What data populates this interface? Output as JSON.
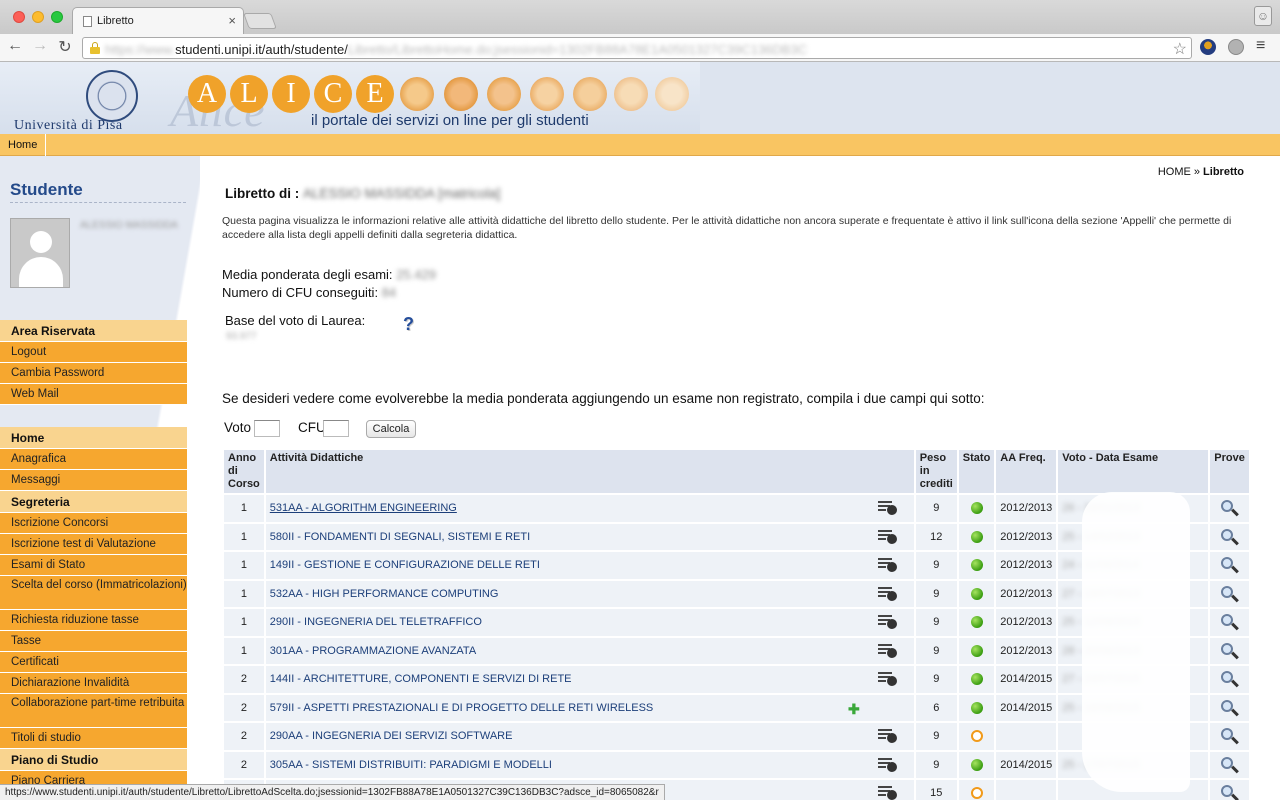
{
  "browser": {
    "tab_title": "Libretto",
    "url_visible": "studenti.unipi.it/auth/studente/",
    "url_blurred_pre": "https://www.",
    "url_blurred_post": "Libretto/LibrettoHome.do;jsessionid=1302FB88A78E1A0501327C39C136DB3C"
  },
  "header": {
    "university": "Università di Pisa",
    "alice_letters": [
      "A",
      "L",
      "I",
      "C",
      "E"
    ],
    "alice_script": "Alice",
    "tagline": "il portale dei servizi on line per gli studenti",
    "menu_home": "Home"
  },
  "sidebar": {
    "title": "Studente",
    "student_name": "ALESSIO MASSIDDA",
    "area_riservata": {
      "heading": "Area Riservata",
      "items": [
        "Logout",
        "Cambia Password",
        "Web Mail"
      ]
    },
    "home": {
      "heading": "Home",
      "items": [
        "Anagrafica",
        "Messaggi"
      ]
    },
    "segreteria": {
      "heading": "Segreteria",
      "items": [
        "Iscrizione Concorsi",
        "Iscrizione test di Valutazione",
        "Esami di Stato",
        "Scelta del corso (Immatricolazioni)",
        "Richiesta riduzione tasse",
        "Tasse",
        "Certificati",
        "Dichiarazione Invalidità",
        "Collaborazione part-time retribuita",
        "Titoli di studio"
      ]
    },
    "piano": {
      "heading": "Piano di Studio",
      "items": [
        "Piano Carriera"
      ]
    }
  },
  "main": {
    "breadcrumb_home": "HOME",
    "breadcrumb_sep": " » ",
    "breadcrumb_current": "Libretto",
    "heading": "Libretto di :",
    "heading_student": "ALESSIO MASSIDDA [matricola]",
    "intro": "Questa pagina visualizza le informazioni relative alle attività didattiche del libretto dello studente. Per le attività didattiche non ancora superate e frequentate è attivo il link sull'icona della sezione 'Appelli' che permette di accedere alla lista degli appelli definiti dalla segreteria didattica.",
    "media_label": "Media ponderata degli esami:",
    "media_value": "25.429",
    "cfu_label": "Numero di CFU conseguiti:",
    "cfu_value": "84",
    "base_label": "Base del voto di Laurea:",
    "base_value": "93.977",
    "sim_text": "Se desideri vedere come evolverebbe la media ponderata aggiungendo un esame non registrato, compila i due campi qui sotto:",
    "voto_label": "Voto",
    "cfu_input_label": "CFU",
    "calc_button": "Calcola"
  },
  "table": {
    "headers": {
      "anno": "Anno di Corso",
      "attivita": "Attività Didattiche",
      "peso": "Peso in crediti",
      "stato": "Stato",
      "aa": "AA Freq.",
      "voto": "Voto - Data Esame",
      "prove": "Prove"
    },
    "rows": [
      {
        "anno": "1",
        "attivita": "531AA - ALGORITHM ENGINEERING",
        "peso": "9",
        "stato": "green",
        "aa": "2012/2013",
        "voto": "26 - 16/01/2013",
        "icon": "appelli"
      },
      {
        "anno": "1",
        "attivita": "580II - FONDAMENTI DI SEGNALI, SISTEMI E RETI",
        "peso": "12",
        "stato": "green",
        "aa": "2012/2013",
        "voto": "25 - 14/02/2013",
        "icon": "appelli"
      },
      {
        "anno": "1",
        "attivita": "149II - GESTIONE E CONFIGURAZIONE DELLE RETI",
        "peso": "9",
        "stato": "green",
        "aa": "2012/2013",
        "voto": "24 - 11/06/2014",
        "icon": "appelli"
      },
      {
        "anno": "1",
        "attivita": "532AA - HIGH PERFORMANCE COMPUTING",
        "peso": "9",
        "stato": "green",
        "aa": "2012/2013",
        "voto": "27 - 19/07/2013",
        "icon": "appelli"
      },
      {
        "anno": "1",
        "attivita": "290II - INGEGNERIA DEL TELETRAFFICO",
        "peso": "9",
        "stato": "green",
        "aa": "2012/2013",
        "voto": "25 - 12/09/2013",
        "icon": "appelli"
      },
      {
        "anno": "1",
        "attivita": "301AA - PROGRAMMAZIONE AVANZATA",
        "peso": "9",
        "stato": "green",
        "aa": "2012/2013",
        "voto": "28 - 20/06/2013",
        "icon": "appelli"
      },
      {
        "anno": "2",
        "attivita": "144II - ARCHITETTURE, COMPONENTI E SERVIZI DI RETE",
        "peso": "9",
        "stato": "green",
        "aa": "2014/2015",
        "voto": "27 - 24/07/2015",
        "icon": "appelli"
      },
      {
        "anno": "2",
        "attivita": "579II - ASPETTI PRESTAZIONALI E DI PROGETTO DELLE RETI WIRELESS",
        "peso": "6",
        "stato": "green",
        "aa": "2014/2015",
        "voto": "25 - 16/09/2015",
        "icon": "plus"
      },
      {
        "anno": "2",
        "attivita": "290AA - INGEGNERIA DEI SERVIZI SOFTWARE",
        "peso": "9",
        "stato": "orange",
        "aa": "",
        "voto": "",
        "icon": "appelli"
      },
      {
        "anno": "2",
        "attivita": "305AA - SISTEMI DISTRIBUITI: PARADIGMI E MODELLI",
        "peso": "9",
        "stato": "green",
        "aa": "2014/2015",
        "voto": "25 - 17/07/2015",
        "icon": "appelli"
      },
      {
        "anno": "",
        "attivita": "",
        "peso": "15",
        "stato": "orange",
        "aa": "",
        "voto": "",
        "icon": "appelli"
      }
    ]
  },
  "status_bar": "https://www.studenti.unipi.it/auth/studente/Libretto/LibrettoAdScelta.do;jsessionid=1302FB88A78E1A0501327C39C136DB3C?adsce_id=8065082&r",
  "colors": {
    "accent_orange": "#f6a72f",
    "menubar": "#f9c562",
    "brand_blue": "#244a8a",
    "stato_green": "#3a9d11",
    "stato_orange": "#f19a1a"
  }
}
